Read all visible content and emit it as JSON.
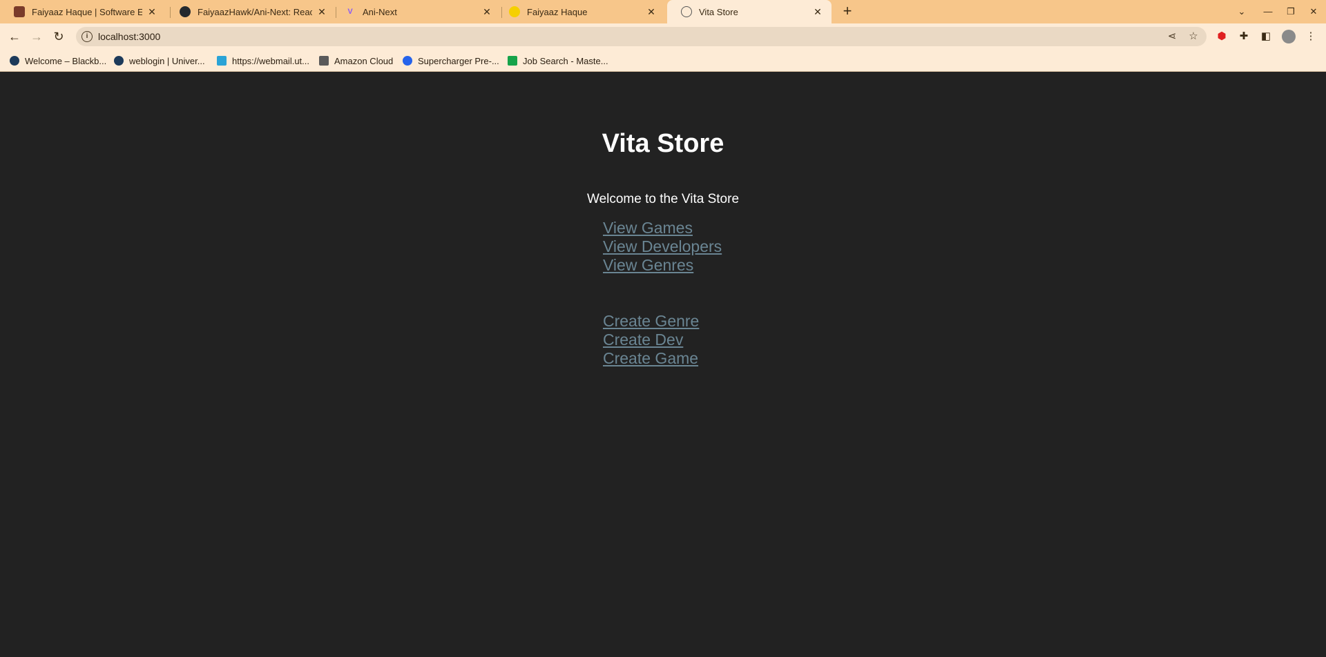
{
  "browser": {
    "tabs": [
      {
        "title": "Faiyaaz Haque | Software Engi",
        "active": false
      },
      {
        "title": "FaiyaazHawk/Ani-Next: React fr",
        "active": false
      },
      {
        "title": "Ani-Next",
        "active": false
      },
      {
        "title": "Faiyaaz Haque",
        "active": false
      },
      {
        "title": "Vita Store",
        "active": true
      }
    ],
    "close_glyph": "✕",
    "new_tab_glyph": "+",
    "url": "localhost:3000",
    "bookmarks": [
      {
        "label": "Welcome – Blackb..."
      },
      {
        "label": "weblogin | Univer..."
      },
      {
        "label": "https://webmail.ut..."
      },
      {
        "label": "Amazon Cloud"
      },
      {
        "label": "Supercharger Pre-..."
      },
      {
        "label": "Job Search - Maste..."
      }
    ]
  },
  "page": {
    "title": "Vita Store",
    "welcome": "Welcome to the Vita Store",
    "view_links": [
      {
        "label": "View Games"
      },
      {
        "label": "View Developers"
      },
      {
        "label": "View Genres"
      }
    ],
    "create_links": [
      {
        "label": "Create Genre"
      },
      {
        "label": "Create Dev"
      },
      {
        "label": "Create Game"
      }
    ]
  },
  "colors": {
    "tabstrip": "#f7c68a",
    "toolbar": "#fdebd6",
    "page_bg": "#222222",
    "link": "#6a8593"
  }
}
